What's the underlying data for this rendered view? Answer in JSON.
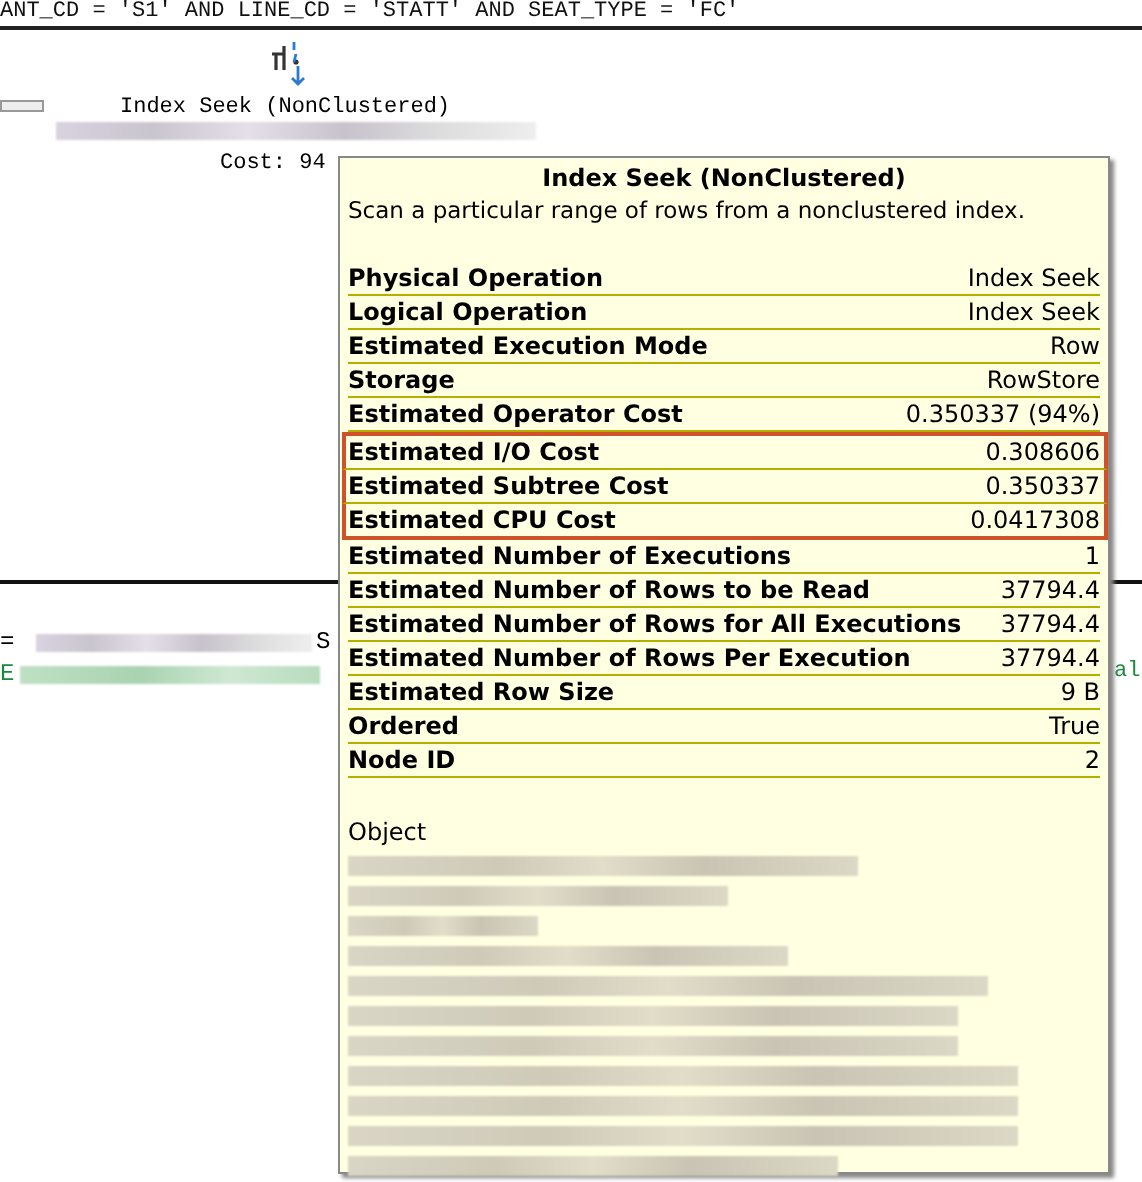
{
  "query_top": {
    "text": "ANT_CD = 'S1' AND LINE_CD = 'STATT' AND SEAT_TYPE = 'FC'"
  },
  "plan_node": {
    "title": "Index Seek (NonClustered)",
    "cost": "Cost: 94 "
  },
  "tooltip": {
    "title": "Index Seek (NonClustered)",
    "description": "Scan a particular range of rows from a nonclustered index.",
    "properties": [
      {
        "label": "Physical Operation",
        "value": "Index Seek",
        "highlighted": false
      },
      {
        "label": "Logical Operation",
        "value": "Index Seek",
        "highlighted": false
      },
      {
        "label": "Estimated Execution Mode",
        "value": "Row",
        "highlighted": false
      },
      {
        "label": "Storage",
        "value": "RowStore",
        "highlighted": false
      },
      {
        "label": "Estimated Operator Cost",
        "value": "0.350337 (94%)",
        "highlighted": false
      },
      {
        "label": "Estimated I/O Cost",
        "value": "0.308606",
        "highlighted": true
      },
      {
        "label": "Estimated Subtree Cost",
        "value": "0.350337",
        "highlighted": true
      },
      {
        "label": "Estimated CPU Cost",
        "value": "0.0417308",
        "highlighted": true
      },
      {
        "label": "Estimated Number of Executions",
        "value": "1",
        "highlighted": false
      },
      {
        "label": "Estimated Number of Rows to be Read",
        "value": "37794.4",
        "highlighted": false
      },
      {
        "label": "Estimated Number of Rows for All Executions",
        "value": "37794.4",
        "highlighted": false
      },
      {
        "label": "Estimated Number of Rows Per Execution",
        "value": "37794.4",
        "highlighted": false
      },
      {
        "label": "Estimated Row Size",
        "value": "9 B",
        "highlighted": false
      },
      {
        "label": "Ordered",
        "value": "True",
        "highlighted": false
      },
      {
        "label": "Node ID",
        "value": "2",
        "highlighted": false
      }
    ],
    "object_label": "Object"
  },
  "query_bottom": {
    "line_1_start": "=",
    "line_1_end": "S",
    "line_2_start": "E",
    "line_2_end": "al"
  }
}
